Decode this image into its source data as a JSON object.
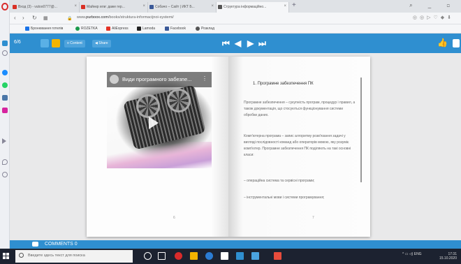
{
  "browser": {
    "tabs": [
      {
        "label": "Вход (3) - vutoo0777@...",
        "color": "#d93025"
      },
      {
        "label": "Майнкр или: даже гер...",
        "color": "#d93025"
      },
      {
        "label": "Собачо – Сайт | ИКТ Б...",
        "color": "#3b5998"
      },
      {
        "label": "Структура інформаційно...",
        "color": "#555555"
      }
    ],
    "url_prefix": "www.",
    "url_host": "purboox.com",
    "url_path": "/books/struktura-informacijnoi-systemi/",
    "bookmarks": [
      {
        "label": "Бронювання готелів",
        "color": "#1a73e8"
      },
      {
        "label": "ROZETKA",
        "color": "#1a9a4a"
      },
      {
        "label": "AliExpress",
        "color": "#e43226"
      },
      {
        "label": "Lamoda",
        "color": "#222222"
      },
      {
        "label": "Facebook",
        "color": "#3b5998"
      },
      {
        "label": "Розклад",
        "color": "#555555"
      }
    ]
  },
  "toolbar": {
    "page_counter": "6/6",
    "btn_contents": "≡ Content",
    "btn_share": "◀ Share"
  },
  "video": {
    "title": "Види програмного забезпе...",
    "more": "⋮"
  },
  "left_page": {
    "number": "6"
  },
  "right_page": {
    "number": "7",
    "title": "1. Програмне забезпечення ПК",
    "paragraphs": [
      "Програмне забезпечення – сукупність програм, процедур і правил, а також документація, що стосуються функціонування системи обробки даних.",
      "Комп'ютерна програма – запис алгоритму розв'язання задачі у вигляді послідовності команд або операторів мовою, яку розуміє комп'ютер. Програмне забезпечення ПК поділяють на такі основні класи:",
      "– операційна система та сервісні програми;",
      "– інструментальні мови і системи програмування;"
    ]
  },
  "comments": {
    "label": "COMMENTS 0"
  },
  "taskbar": {
    "search_placeholder": "Введите здесь текст для поиска",
    "time": "17:31",
    "date": "15.10.2020"
  }
}
